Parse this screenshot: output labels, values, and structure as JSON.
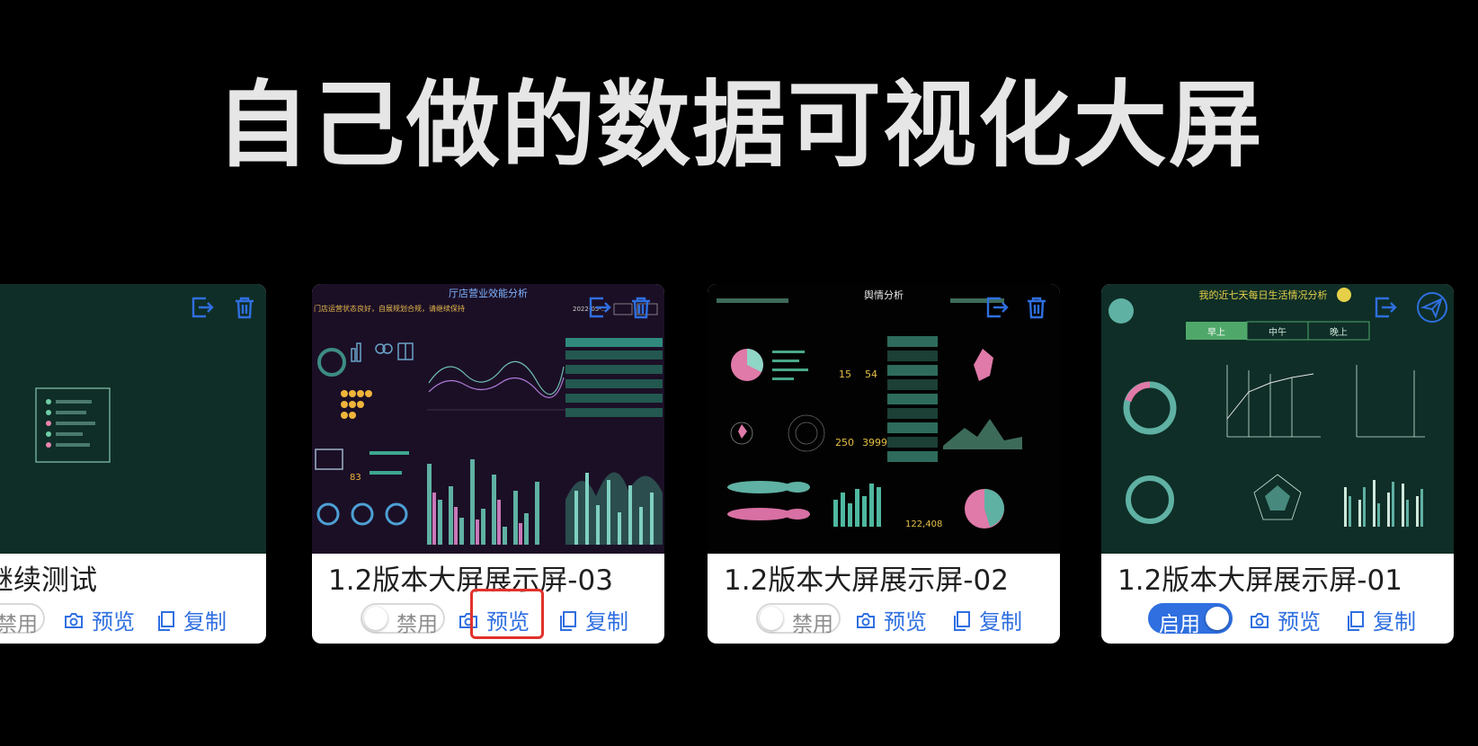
{
  "page": {
    "title": "自己做的数据可视化大屏"
  },
  "cards": [
    {
      "name": "名字继续测试",
      "toggle_label": "禁用",
      "enabled": false,
      "preview_label": "预览",
      "copy_label": "复制",
      "thumbnail": {
        "lines": [
          "",
          "",
          "",
          "",
          ""
        ]
      }
    },
    {
      "name": "1.2版本大屏展示屏-03",
      "toggle_label": "禁用",
      "enabled": false,
      "preview_label": "预览",
      "copy_label": "复制",
      "preview_highlighted": true,
      "thumbnail": {
        "title": "厅店营业效能分析",
        "subtitle": "门店运营状态良好，自展规划合规，请继续保持",
        "date": "2022-05-...",
        "value_a": "83"
      }
    },
    {
      "name": "1.2版本大屏展示屏-02",
      "toggle_label": "禁用",
      "enabled": false,
      "preview_label": "预览",
      "copy_label": "复制",
      "thumbnail": {
        "title": "舆情分析",
        "num_a": "15",
        "num_b": "54",
        "num_c": "250",
        "num_d": "3999",
        "num_e": "122,408"
      }
    },
    {
      "name": "1.2版本大屏展示屏-01",
      "toggle_label": "启用",
      "enabled": true,
      "preview_label": "预览",
      "copy_label": "复制",
      "thumbnail": {
        "title": "我的近七天每日生活情况分析",
        "tabs": [
          "早上",
          "中午",
          "晚上"
        ]
      }
    }
  ],
  "colors": {
    "accent": "#2f6fe0",
    "highlight": "#e0322b",
    "thumb_green": "#0f2e27",
    "thumb_purple": "#1b0f26",
    "thumb_black": "#020202"
  }
}
